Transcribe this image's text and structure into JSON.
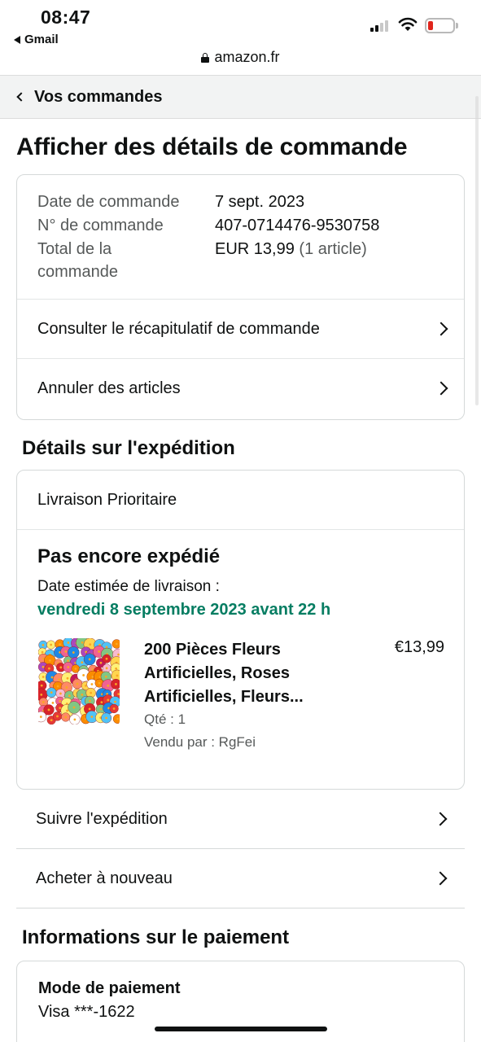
{
  "status_bar": {
    "time": "08:47",
    "back_app": "Gmail",
    "url": "amazon.fr",
    "icons": [
      "signal-icon",
      "wifi-icon",
      "battery-icon",
      "lock-icon"
    ]
  },
  "breadcrumb": {
    "label": "Vos commandes"
  },
  "page_title": "Afficher des détails de commande",
  "order_summary": {
    "date_label": "Date de commande",
    "date_value": "7 sept. 2023",
    "number_label": "N° de commande",
    "number_value": "407-0714476-9530758",
    "total_label_line1": "Total de la",
    "total_label_line2": "commande",
    "total_value": "EUR 13,99",
    "total_items": "(1 article)",
    "actions": [
      {
        "label": "Consulter le récapitulatif de commande"
      },
      {
        "label": "Annuler des articles"
      }
    ]
  },
  "shipment": {
    "section_title": "Détails sur l'expédition",
    "speed": "Livraison Prioritaire",
    "status": "Pas encore expédié",
    "estimate_label": "Date estimée de livraison :",
    "estimate_date": "vendredi 8 septembre 2023 avant 22 h",
    "estimate_color": "#067d62",
    "item": {
      "title": "200 Pièces Fleurs Artificielles, Roses Artificielles, Fleurs...",
      "price": "€13,99",
      "qty": "Qté : 1",
      "seller": "Vendu par : RgFei"
    },
    "actions": [
      {
        "label": "Suivre l'expédition"
      },
      {
        "label": "Acheter à nouveau"
      }
    ]
  },
  "payment": {
    "section_title": "Informations sur le paiement",
    "method_label": "Mode de paiement",
    "method_value": "Visa  ***-1622"
  }
}
